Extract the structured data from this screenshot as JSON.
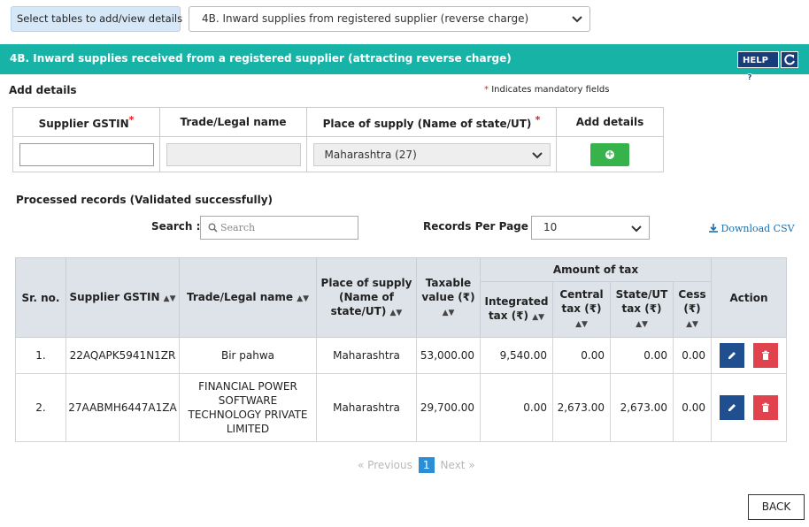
{
  "selector": {
    "label": "Select tables to add/view details",
    "value": "4B. Inward supplies from registered supplier (reverse charge)"
  },
  "section": {
    "title": "4B. Inward supplies received from a registered supplier (attracting reverse charge)",
    "help_label": "HELP",
    "help_glyph": "?"
  },
  "add_details": {
    "heading": "Add details",
    "mandatory_star": "*",
    "mandatory_note": "Indicates mandatory fields",
    "columns": {
      "gstin": "Supplier GSTIN",
      "trade_name": "Trade/Legal name",
      "place_of_supply": "Place of supply (Name of state/UT)",
      "add": "Add details"
    },
    "required_mark": "*",
    "gstin_value": "",
    "trade_name_value": "",
    "place_of_supply_value": "Maharashtra (27)",
    "add_glyph": "+"
  },
  "processed": {
    "heading": "Processed records (Validated successfully)",
    "search_label": "Search :",
    "search_placeholder": "Search",
    "records_per_page_label": "Records Per Page :",
    "records_per_page_value": "10",
    "download_csv": "Download CSV"
  },
  "table": {
    "headers": {
      "sr_no": "Sr. no.",
      "gstin": "Supplier GSTIN",
      "trade_name": "Trade/Legal name",
      "place_of_supply": "Place of supply (Name of state/UT)",
      "taxable_value": "Taxable value (₹)",
      "amount_of_tax": "Amount of tax",
      "integrated_tax": "Integrated tax (₹)",
      "central_tax": "Central tax (₹)",
      "state_tax": "State/UT tax (₹)",
      "cess": "Cess (₹)",
      "action": "Action"
    },
    "rows": [
      {
        "sr": "1.",
        "gstin": "22AQAPK5941N1ZR",
        "trade_name": "Bir pahwa",
        "place": "Maharashtra",
        "taxable": "53,000.00",
        "integrated": "9,540.00",
        "central": "0.00",
        "state": "0.00",
        "cess": "0.00"
      },
      {
        "sr": "2.",
        "gstin": "27AABMH6447A1ZA",
        "trade_name": "FINANCIAL POWER SOFTWARE TECHNOLOGY PRIVATE LIMITED",
        "place": "Maharashtra",
        "taxable": "29,700.00",
        "integrated": "0.00",
        "central": "2,673.00",
        "state": "2,673.00",
        "cess": "0.00"
      }
    ]
  },
  "pagination": {
    "first": "«",
    "previous": "Previous",
    "current": "1",
    "next": "Next",
    "last": "»"
  },
  "back_label": "BACK",
  "colors": {
    "teal": "#17b3a7",
    "navy": "#173e7a",
    "add_green": "#36b34a",
    "edit_blue": "#1f4f8f",
    "delete_red": "#e0434d",
    "link_blue": "#1b6fb0"
  }
}
